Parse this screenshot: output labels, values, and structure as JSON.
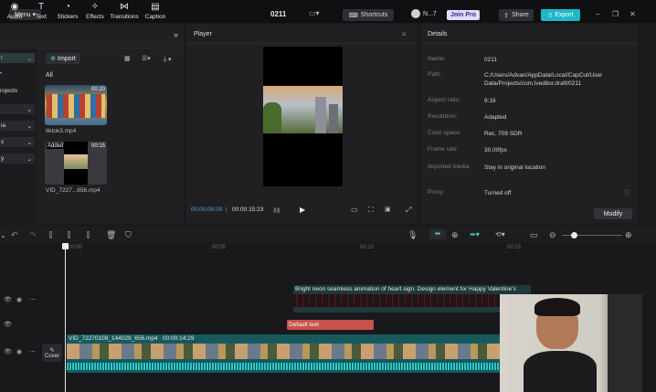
{
  "topbar": {
    "menu_label": "Menu",
    "project_title": "0211",
    "shortcuts_label": "Shortcuts",
    "user_label": "N...7",
    "joinpro_label": "Join Pro",
    "share_label": "Share",
    "export_label": "Export"
  },
  "toolbar": {
    "tools": [
      {
        "icon": "audio-icon",
        "label": "Audio"
      },
      {
        "icon": "text-icon",
        "label": "Text"
      },
      {
        "icon": "stickers-icon",
        "label": "Stickers"
      },
      {
        "icon": "effects-icon",
        "label": "Effects"
      },
      {
        "icon": "transitions-icon",
        "label": "Transitions"
      },
      {
        "icon": "caption-icon",
        "label": "Caption"
      }
    ]
  },
  "sidebar": {
    "items": [
      "t",
      "rojects",
      "ia",
      "s",
      "y"
    ]
  },
  "media": {
    "import_label": "Import",
    "filter_label": "All",
    "files": [
      {
        "name": "tiktok3.mp4",
        "badge": "00:20"
      },
      {
        "name": "VID_7227...656.mp4",
        "badge": "00:15",
        "status": "Added"
      }
    ]
  },
  "player": {
    "title": "Player",
    "current_time": "00:00:00:00",
    "total_time": "00:00:15:23"
  },
  "details": {
    "title": "Details",
    "rows": [
      {
        "key": "Name:",
        "value": "0211"
      },
      {
        "key": "Path:",
        "value": "C:/Users/Advan/AppData/Local/CapCut/User Data/Projects/com.lveditor.draft/0211"
      },
      {
        "key": "Aspect ratio:",
        "value": "9:16"
      },
      {
        "key": "Resolution:",
        "value": "Adapted"
      },
      {
        "key": "Color space:",
        "value": "Rec. 709 SDR"
      },
      {
        "key": "Frame rate:",
        "value": "30.00fps"
      },
      {
        "key": "Imported media:",
        "value": "Stay in original location"
      },
      {
        "key": "Proxy:",
        "value": "Turned off"
      }
    ],
    "modify_label": "Modify"
  },
  "timeline": {
    "ticks": [
      "00:00",
      "00:05",
      "00:10",
      "00:15"
    ],
    "anim_clip_label": "Bright neon seamless animation of heart sign. Design element for Happy Valentine's",
    "text_clip_label": "Default text",
    "video_clip_label": "VID_72270109_144029_656.mp4   00:00:14:29",
    "cover_label": "Cover"
  },
  "colors": {
    "accent": "#1fb8c8",
    "text_clip": "#c8524a",
    "video_clip": "#165a5e"
  }
}
